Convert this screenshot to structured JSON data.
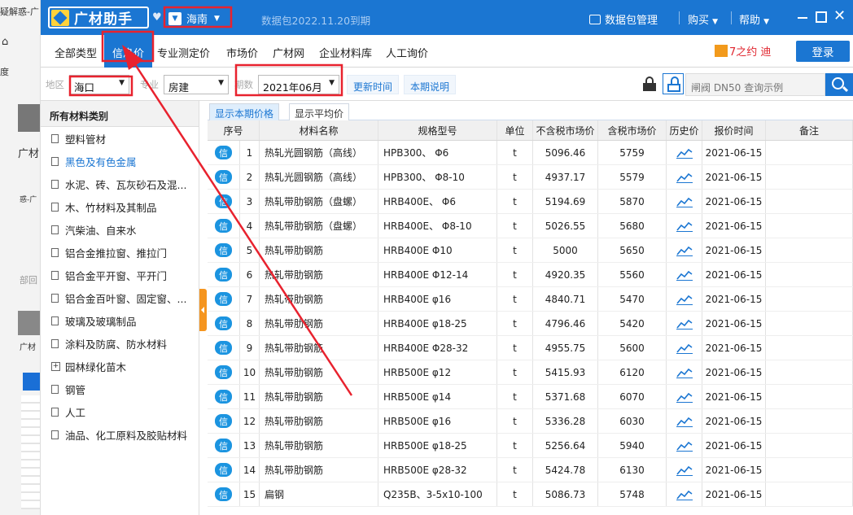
{
  "background": {
    "texts": [
      "疑解惑-广",
      "度",
      "广材",
      "惑-广",
      "部回",
      "广材"
    ]
  },
  "titlebar": {
    "logo_text": "广材助手",
    "region": "海南",
    "expiry": "数据包2022.11.20到期",
    "package_manager": "数据包管理",
    "buy": "购买",
    "help": "帮助",
    "close_symbol": "✕"
  },
  "nav": {
    "items": [
      "全部类型",
      "信息价",
      "专业测定价",
      "市场价",
      "广材网",
      "企业材料库",
      "人工询价"
    ],
    "active_index": 1,
    "promo": "7之约 迪",
    "login": "登录"
  },
  "filter": {
    "area_label": "地区",
    "area_value": "海口",
    "major_label": "专业",
    "major_value": "房建",
    "period_label": "期数",
    "period_value": "2021年06月",
    "update_time_button": "更新时间",
    "period_note_button": "本期说明",
    "search_placeholder": "闸阀 DN50 查询示例"
  },
  "sidebar": {
    "title": "所有材料类别",
    "categories": [
      {
        "label": "塑料管材",
        "type": "doc"
      },
      {
        "label": "黑色及有色金属",
        "type": "doc",
        "active": true
      },
      {
        "label": "水泥、砖、瓦灰砂石及混...",
        "type": "doc"
      },
      {
        "label": "木、竹材料及其制品",
        "type": "doc"
      },
      {
        "label": "汽柴油、自来水",
        "type": "doc"
      },
      {
        "label": "铝合金推拉窗、推拉门",
        "type": "doc"
      },
      {
        "label": "铝合金平开窗、平开门",
        "type": "doc"
      },
      {
        "label": "铝合金百叶窗、固定窗、...",
        "type": "doc"
      },
      {
        "label": "玻璃及玻璃制品",
        "type": "doc"
      },
      {
        "label": "涂料及防腐、防水材料",
        "type": "doc"
      },
      {
        "label": "园林绿化苗木",
        "type": "plus"
      },
      {
        "label": "钢管",
        "type": "doc"
      },
      {
        "label": "人工",
        "type": "doc"
      },
      {
        "label": "油品、化工原料及胶贴材料",
        "type": "doc"
      }
    ]
  },
  "main": {
    "tabs": [
      "显示本期价格",
      "显示平均价"
    ],
    "active_tab": 0,
    "columns": [
      "序号",
      "材料名称",
      "规格型号",
      "单位",
      "不含税市场价",
      "含税市场价",
      "历史价",
      "报价时间",
      "备注"
    ],
    "badge": "信",
    "rows": [
      [
        "1",
        "热轧光圆钢筋（高线）",
        "HPB300、 Φ6",
        "t",
        "5096.46",
        "5759",
        "2021-06-15",
        ""
      ],
      [
        "2",
        "热轧光圆钢筋（高线）",
        "HPB300、 Φ8-10",
        "t",
        "4937.17",
        "5579",
        "2021-06-15",
        ""
      ],
      [
        "3",
        "热轧带肋钢筋（盘螺）",
        "HRB400E、 Φ6",
        "t",
        "5194.69",
        "5870",
        "2021-06-15",
        ""
      ],
      [
        "4",
        "热轧带肋钢筋（盘螺）",
        "HRB400E、 Φ8-10",
        "t",
        "5026.55",
        "5680",
        "2021-06-15",
        ""
      ],
      [
        "5",
        "热轧带肋钢筋",
        "HRB400E Φ10",
        "t",
        "5000",
        "5650",
        "2021-06-15",
        ""
      ],
      [
        "6",
        "热轧带肋钢筋",
        "HRB400E Φ12-14",
        "t",
        "4920.35",
        "5560",
        "2021-06-15",
        ""
      ],
      [
        "7",
        "热轧带肋钢筋",
        "HRB400E φ16",
        "t",
        "4840.71",
        "5470",
        "2021-06-15",
        ""
      ],
      [
        "8",
        "热轧带肋钢筋",
        "HRB400E φ18-25",
        "t",
        "4796.46",
        "5420",
        "2021-06-15",
        ""
      ],
      [
        "9",
        "热轧带肋钢筋",
        "HRB400E Φ28-32",
        "t",
        "4955.75",
        "5600",
        "2021-06-15",
        ""
      ],
      [
        "10",
        "热轧带肋钢筋",
        "HRB500E φ12",
        "t",
        "5415.93",
        "6120",
        "2021-06-15",
        ""
      ],
      [
        "11",
        "热轧带肋钢筋",
        "HRB500E φ14",
        "t",
        "5371.68",
        "6070",
        "2021-06-15",
        ""
      ],
      [
        "12",
        "热轧带肋钢筋",
        "HRB500E φ16",
        "t",
        "5336.28",
        "6030",
        "2021-06-15",
        ""
      ],
      [
        "13",
        "热轧带肋钢筋",
        "HRB500E φ18-25",
        "t",
        "5256.64",
        "5940",
        "2021-06-15",
        ""
      ],
      [
        "14",
        "热轧带肋钢筋",
        "HRB500E φ28-32",
        "t",
        "5424.78",
        "6130",
        "2021-06-15",
        ""
      ],
      [
        "15",
        "扁钢",
        "Q235B、3-5x10-100",
        "t",
        "5086.73",
        "5748",
        "2021-06-15",
        ""
      ]
    ]
  },
  "annotation": {
    "color": "#e8222e"
  }
}
